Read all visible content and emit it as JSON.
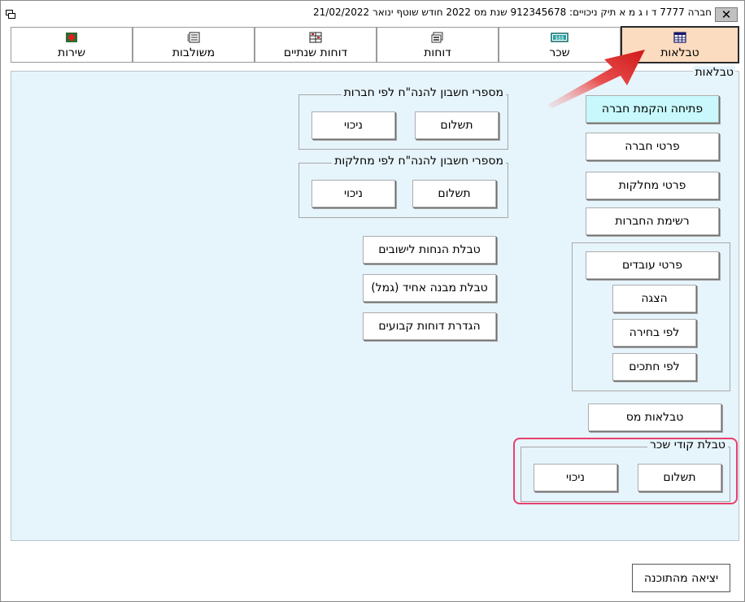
{
  "window": {
    "title": "חברה 7777 ד ו ג מ א תיק ניכויים: 912345678   שנת מס 2022   חודש שוטף ינואר   21/02/2022",
    "close_glyph": "✕"
  },
  "tabs": [
    {
      "label": "טבלאות",
      "icon": "table-icon",
      "active": true
    },
    {
      "label": "שכר",
      "icon": "salary-icon",
      "active": false
    },
    {
      "label": "דוחות",
      "icon": "reports-icon",
      "active": false
    },
    {
      "label": "דוחות שנתיים",
      "icon": "annual-reports-icon",
      "active": false
    },
    {
      "label": "משולבות",
      "icon": "combined-icon",
      "active": false
    },
    {
      "label": "שירות",
      "icon": "service-icon",
      "active": false
    }
  ],
  "content": {
    "title": "טבלאות",
    "right_buttons": {
      "open_company": "פתיחה והקמת חברה",
      "company_details": "פרטי חברה",
      "department_details": "פרטי מחלקות",
      "company_list": "רשימת החברות",
      "tax_tables": "טבלאות מס"
    },
    "employees_group": {
      "employee_details": "פרטי עובדים",
      "display": "הצגה",
      "by_selection": "לפי בחירה",
      "by_sections": "לפי חתכים"
    },
    "salary_codes_group": {
      "legend": "טבלת קודי שכר",
      "payment": "תשלום",
      "deduction": "ניכוי"
    },
    "accounts_by_company": {
      "legend": "מספרי חשבון להנה\"ח לפי חברות",
      "payment": "תשלום",
      "deduction": "ניכוי"
    },
    "accounts_by_department": {
      "legend": "מספרי חשבון להנה\"ח לפי מחלקות",
      "payment": "תשלום",
      "deduction": "ניכוי"
    },
    "middle_buttons": {
      "settlement_discounts": "טבלת הנחות לישובים",
      "unified_structure": "טבלת מבנה אחיד (גמל)",
      "fixed_reports": "הגדרת דוחות קבועים"
    }
  },
  "footer": {
    "exit": "יציאה מהתוכנה"
  },
  "colors": {
    "active_tab": "#fcdcc0",
    "content_bg": "#e6f4fb",
    "highlight": "#e8406e",
    "arrow": "#e83030",
    "cyan_button": "#c8f8fc"
  }
}
